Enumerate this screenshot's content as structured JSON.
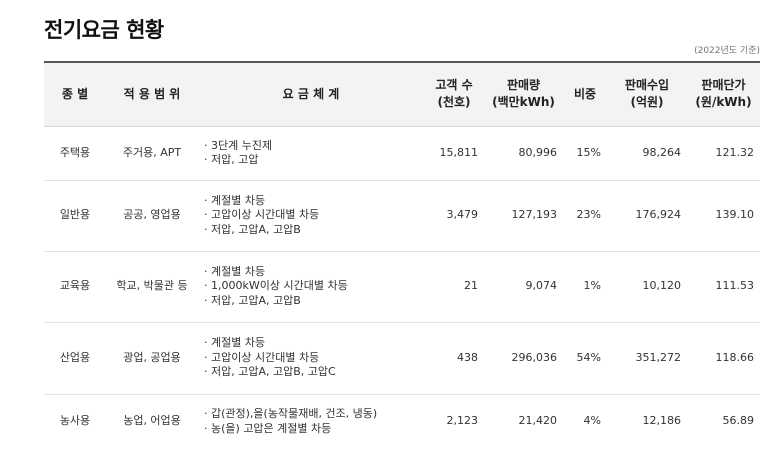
{
  "title": "전기요금 현황",
  "base_note": "(2022년도 기준)",
  "headers": {
    "type": "종 별",
    "scope": "적 용 범 위",
    "scheme": "요 금 체 계",
    "customers": [
      "고객 수",
      "(천호)"
    ],
    "sales_volume": [
      "판매량",
      "(백만kWh)"
    ],
    "share": "비중",
    "revenue": [
      "판매수입",
      "(억원)"
    ],
    "unit_price": [
      "판매단가",
      "(원/kWh)"
    ]
  },
  "rows": [
    {
      "type": "주택용",
      "scope": "주거용, APT",
      "scheme": [
        "· 3단계 누진제",
        "· 저압, 고압"
      ],
      "customers": "15,811",
      "sales_volume": "80,996",
      "share": "15%",
      "revenue": "98,264",
      "unit_price": "121.32"
    },
    {
      "type": "일반용",
      "scope": "공공, 영업용",
      "scheme": [
        "· 계절별 차등",
        "· 고압이상 시간대별 차등",
        "· 저압, 고압A, 고압B"
      ],
      "customers": "3,479",
      "sales_volume": "127,193",
      "share": "23%",
      "revenue": "176,924",
      "unit_price": "139.10"
    },
    {
      "type": "교육용",
      "scope": "학교, 박물관 등",
      "scheme": [
        "· 계절별 차등",
        "· 1,000kW이상 시간대별 차등",
        "· 저압, 고압A, 고압B"
      ],
      "customers": "21",
      "sales_volume": "9,074",
      "share": "1%",
      "revenue": "10,120",
      "unit_price": "111.53"
    },
    {
      "type": "산업용",
      "scope": "광업, 공업용",
      "scheme": [
        "· 계절별 차등",
        "· 고압이상 시간대별 차등",
        "· 저압, 고압A, 고압B, 고압C"
      ],
      "customers": "438",
      "sales_volume": "296,036",
      "share": "54%",
      "revenue": "351,272",
      "unit_price": "118.66"
    },
    {
      "type": "농사용",
      "scope": "농업, 어업용",
      "scheme": [
        "· 갑(관정),을(농작물재배, 건조, 냉동)",
        "· 농(을) 고압은 계절별 차등"
      ],
      "customers": "2,123",
      "sales_volume": "21,420",
      "share": "4%",
      "revenue": "12,186",
      "unit_price": "56.89"
    }
  ]
}
